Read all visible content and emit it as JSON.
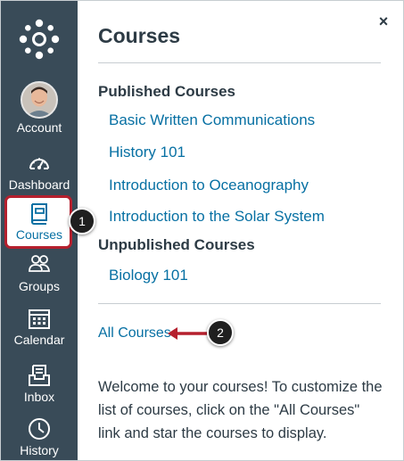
{
  "nav": {
    "items": [
      {
        "label": "Account",
        "icon": "avatar"
      },
      {
        "label": "Dashboard",
        "icon": "dashboard-icon"
      },
      {
        "label": "Courses",
        "icon": "courses-icon",
        "active": true
      },
      {
        "label": "Groups",
        "icon": "groups-icon"
      },
      {
        "label": "Calendar",
        "icon": "calendar-icon"
      },
      {
        "label": "Inbox",
        "icon": "inbox-icon"
      },
      {
        "label": "History",
        "icon": "history-icon"
      }
    ],
    "colors": {
      "background": "#394b58",
      "active_border": "#b5202e",
      "active_text": "#0770a3"
    }
  },
  "tray": {
    "title": "Courses",
    "close": "×",
    "published_heading": "Published Courses",
    "published_courses": [
      "Basic Written Communications",
      "History 101",
      "Introduction to Oceanography",
      "Introduction to the Solar System"
    ],
    "unpublished_heading": "Unpublished Courses",
    "unpublished_courses": [
      "Biology 101"
    ],
    "all_courses_link": "All Courses",
    "welcome_text": "Welcome to your courses! To customize the list of courses, click on the \"All Courses\" link and star the courses to display.",
    "link_color": "#0770a3"
  },
  "callouts": [
    {
      "number": "1"
    },
    {
      "number": "2"
    }
  ]
}
